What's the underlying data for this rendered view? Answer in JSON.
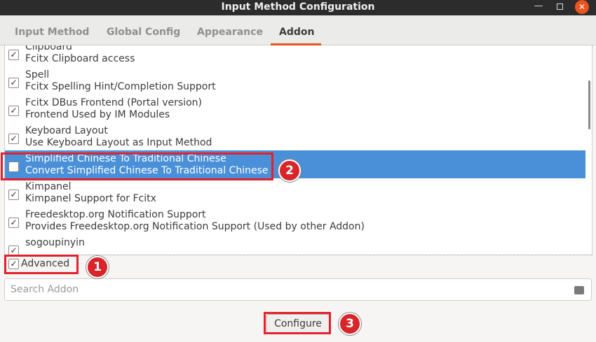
{
  "window": {
    "title": "Input Method Configuration"
  },
  "tabs": [
    {
      "label": "Input Method"
    },
    {
      "label": "Global Config"
    },
    {
      "label": "Appearance"
    },
    {
      "label": "Addon"
    }
  ],
  "addons": [
    {
      "name": "Clipboard",
      "description": "Fcitx Clipboard access",
      "checked": true
    },
    {
      "name": "Spell",
      "description": "Fcitx Spelling Hint/Completion Support",
      "checked": true
    },
    {
      "name": "Fcitx DBus Frontend (Portal version)",
      "description": "Frontend Used by IM Modules",
      "checked": true
    },
    {
      "name": "Keyboard Layout",
      "description": "Use Keyboard Layout as Input Method",
      "checked": true
    },
    {
      "name": "Simplified Chinese To Traditional Chinese",
      "description": "Convert Simplified Chinese To Traditional Chinese",
      "checked": false,
      "selected": true
    },
    {
      "name": "Kimpanel",
      "description": "Kimpanel Support for Fcitx",
      "checked": true
    },
    {
      "name": "Freedesktop.org Notification Support",
      "description": "Provides Freedesktop.org Notification Support (Used by other Addon)",
      "checked": true
    },
    {
      "name": "sogoupinyin",
      "description": "",
      "checked": true
    }
  ],
  "advanced": {
    "label": "Advanced",
    "checked": true
  },
  "search": {
    "placeholder": "Search Addon"
  },
  "configure": {
    "label": "Configure"
  },
  "annotations": [
    {
      "label": "1"
    },
    {
      "label": "2"
    },
    {
      "label": "3"
    }
  ],
  "colors": {
    "accent": "#e95420",
    "selection": "#4a90d9",
    "annotation": "#e3202b"
  }
}
